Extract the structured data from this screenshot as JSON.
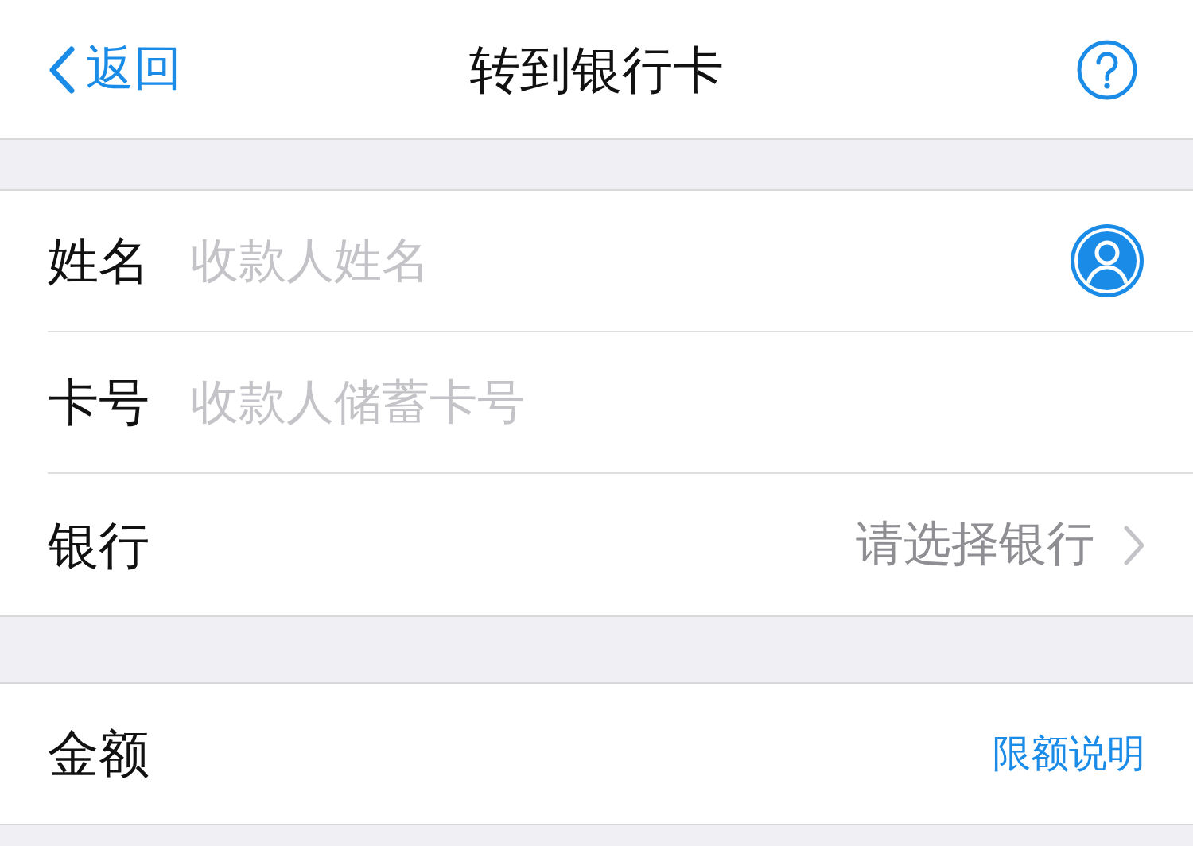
{
  "nav": {
    "back": "返回",
    "title": "转到银行卡"
  },
  "form": [
    {
      "kind": "input",
      "label": "姓名",
      "placeholder": "收款人姓名",
      "contact_button": true
    },
    {
      "kind": "input",
      "label": "卡号",
      "placeholder": "收款人储蓄卡号",
      "contact_button": false
    },
    {
      "kind": "select",
      "label": "银行",
      "value": "请选择银行"
    }
  ],
  "amount": {
    "label": "金额",
    "link": "限额说明"
  }
}
